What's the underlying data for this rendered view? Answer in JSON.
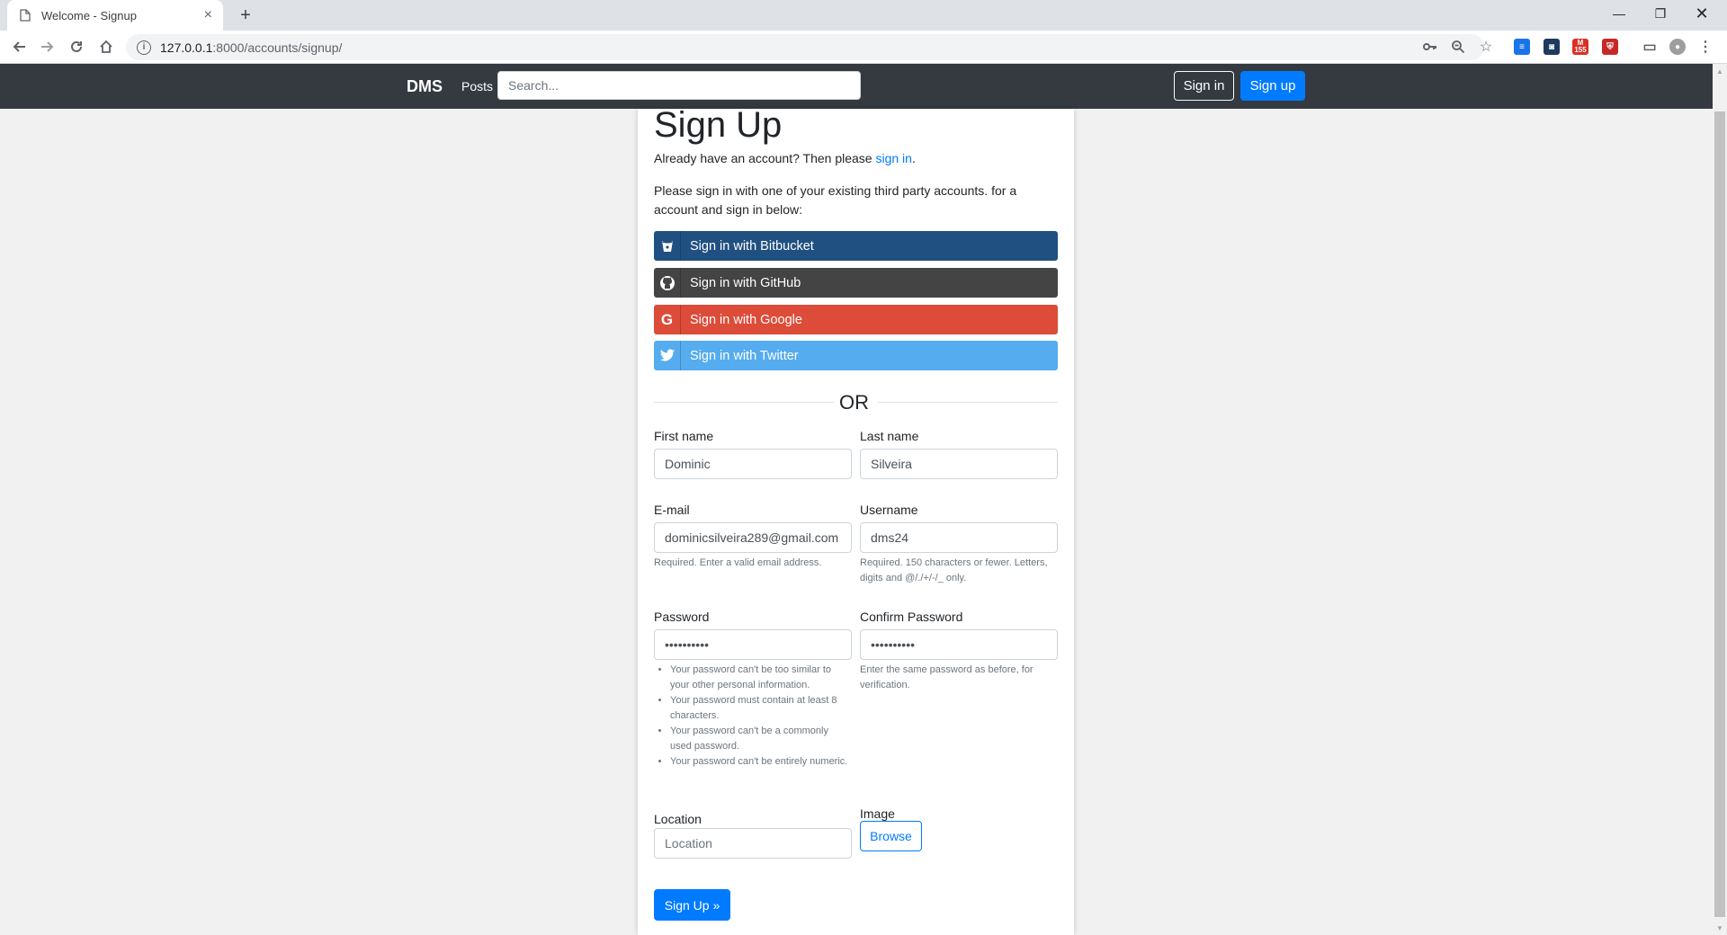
{
  "browser": {
    "tab_title": "Welcome - Signup",
    "tab_close": "×",
    "new_tab": "+",
    "url_host": "127.0.0.1",
    "url_path": ":8000/accounts/signup/",
    "extension_badge": "155"
  },
  "navbar": {
    "brand": "DMS",
    "posts_link": "Posts",
    "search_placeholder": "Search...",
    "signin_label": "Sign in",
    "signup_label": "Sign up"
  },
  "page": {
    "title": "Sign Up",
    "signin_note_prefix": "Already have an account? Then please ",
    "signin_note_link": "sign in",
    "signin_note_suffix": ".",
    "third_party_note": "Please sign in with one of your existing third party accounts. for a account and sign in below:",
    "social": [
      {
        "label": "Sign in with Bitbucket",
        "icon": "bitbucket-icon",
        "color": "#205081"
      },
      {
        "label": "Sign in with GitHub",
        "icon": "github-icon",
        "color": "#444444"
      },
      {
        "label": "Sign in with Google",
        "icon": "google-icon",
        "color": "#dd4b39"
      },
      {
        "label": "Sign in with Twitter",
        "icon": "twitter-icon",
        "color": "#55acee"
      }
    ],
    "or_text": "OR"
  },
  "form": {
    "first_name": {
      "label": "First name",
      "value": "Dominic"
    },
    "last_name": {
      "label": "Last name",
      "value": "Silveira"
    },
    "email": {
      "label": "E-mail",
      "value": "dominicsilveira289@gmail.com",
      "help": "Required. Enter a valid email address."
    },
    "username": {
      "label": "Username",
      "value": "dms24",
      "help": "Required. 150 characters or fewer. Letters, digits and @/./+/-/_ only."
    },
    "password": {
      "label": "Password",
      "value": "••••••••••",
      "help": [
        "Your password can't be too similar to your other personal information.",
        "Your password must contain at least 8 characters.",
        "Your password can't be a commonly used password.",
        "Your password can't be entirely numeric."
      ]
    },
    "confirm_password": {
      "label": "Confirm Password",
      "value": "••••••••••",
      "help": "Enter the same password as before, for verification."
    },
    "location": {
      "label": "Location",
      "placeholder": "Location"
    },
    "image": {
      "label": "Image",
      "browse_label": "Browse"
    },
    "submit_label": "Sign Up »"
  },
  "colors": {
    "primary": "#007bff",
    "navbar": "#343a40"
  }
}
